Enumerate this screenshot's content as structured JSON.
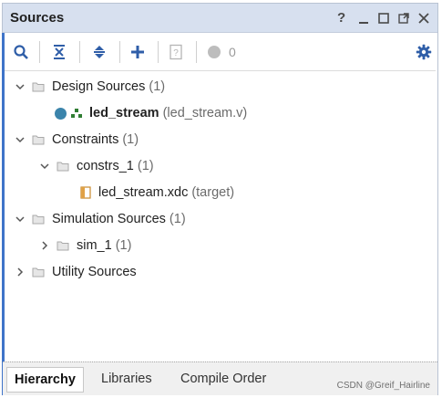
{
  "panel": {
    "title": "Sources"
  },
  "window_controls": {
    "help": "?"
  },
  "toolbar": {
    "status_count": "0"
  },
  "tree": {
    "design_sources": {
      "label": "Design Sources",
      "count": "(1)"
    },
    "led_stream": {
      "label": "led_stream",
      "file": "(led_stream.v)"
    },
    "constraints": {
      "label": "Constraints",
      "count": "(1)"
    },
    "constrs_1": {
      "label": "constrs_1",
      "count": "(1)"
    },
    "xdc": {
      "label": "led_stream.xdc",
      "tag": "(target)"
    },
    "simulation_sources": {
      "label": "Simulation Sources",
      "count": "(1)"
    },
    "sim_1": {
      "label": "sim_1",
      "count": "(1)"
    },
    "utility_sources": {
      "label": "Utility Sources"
    }
  },
  "tabs": {
    "hierarchy": "Hierarchy",
    "libraries": "Libraries",
    "compile_order": "Compile Order"
  },
  "watermark": "CSDN @Greif_Hairline",
  "colors": {
    "accent": "#3f74c9",
    "header_bg": "#d7e0ef",
    "icon_blue": "#2f5ea8",
    "status_gray": "#bdbdbd"
  }
}
